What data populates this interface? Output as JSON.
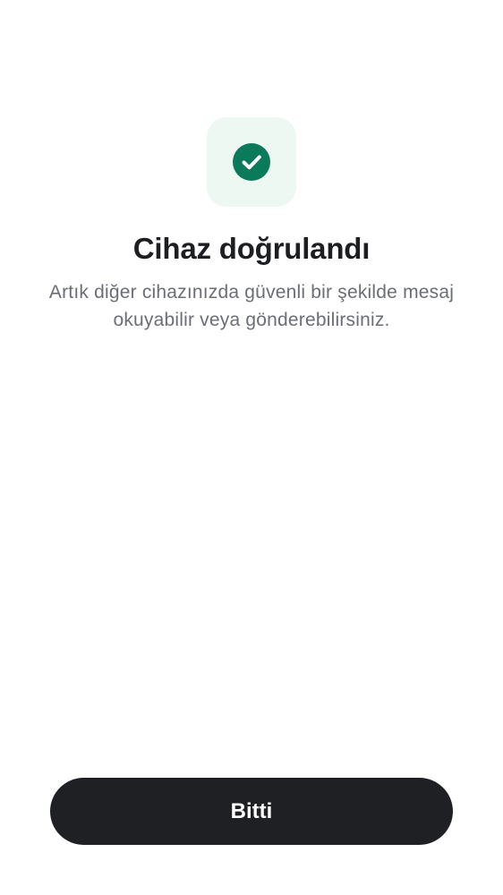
{
  "verification": {
    "icon": "check-circle-icon",
    "accent_color": "#0a7a5a",
    "tile_color": "#eef8f3",
    "title": "Cihaz doğrulandı",
    "subtitle": "Artık diğer cihazınızda güvenli bir şekilde mesaj okuyabilir veya gönderebilirsiniz."
  },
  "actions": {
    "done_label": "Bitti"
  }
}
